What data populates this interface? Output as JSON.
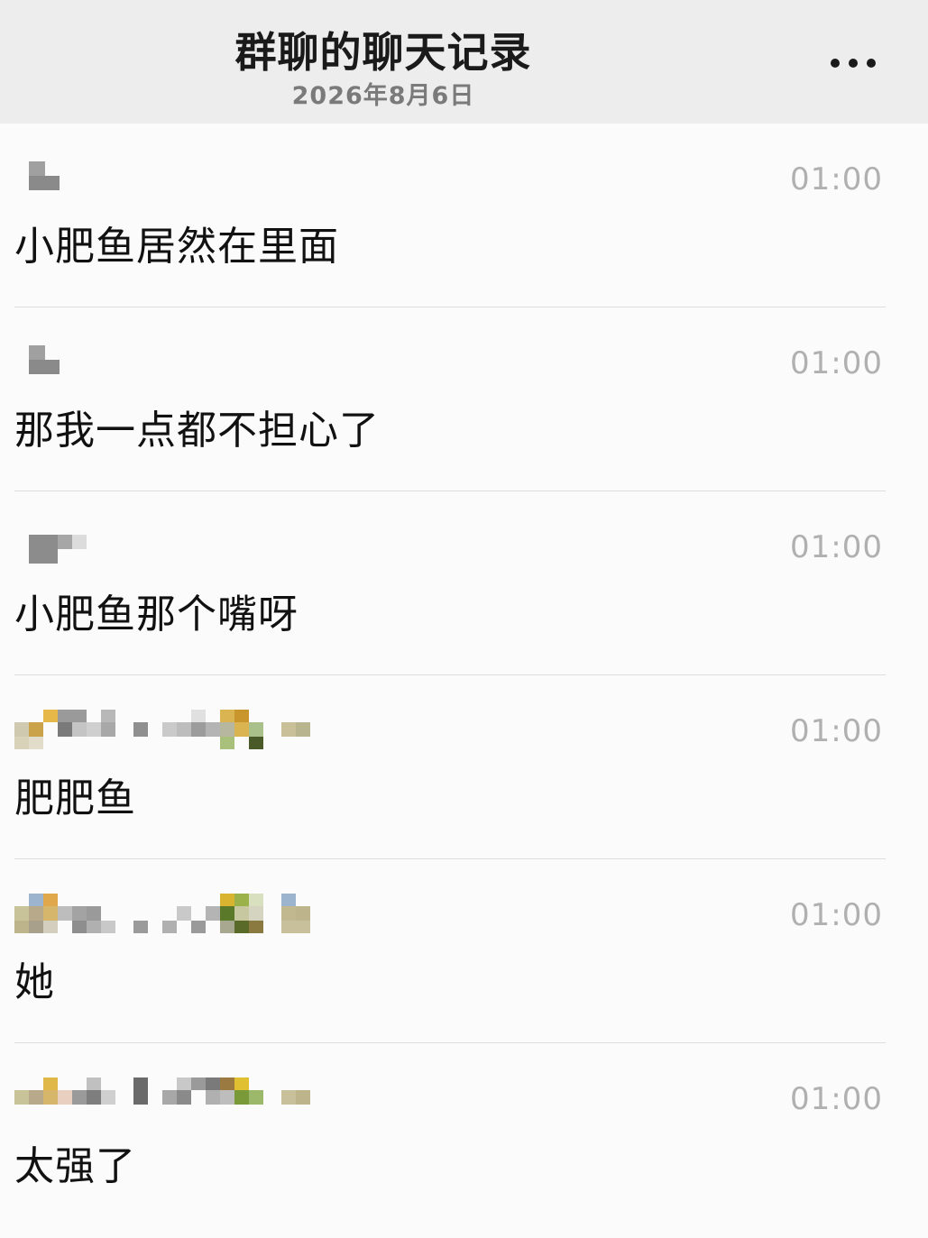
{
  "header": {
    "title": "群聊的聊天记录",
    "date": "2026年8月6日",
    "more_icon": "more-horizontal-icon"
  },
  "messages": [
    {
      "sender": "",
      "time": "01:00",
      "text": "小肥鱼居然在里面"
    },
    {
      "sender": "",
      "time": "01:00",
      "text": "那我一点都不担心了"
    },
    {
      "sender": "",
      "time": "01:00",
      "text": "小肥鱼那个嘴呀"
    },
    {
      "sender": "",
      "time": "01:00",
      "text": "肥肥鱼"
    },
    {
      "sender": "",
      "time": "01:00",
      "text": "她"
    },
    {
      "sender": "",
      "time": "01:00",
      "text": "太强了"
    }
  ],
  "colors": {
    "header_bg": "#ededed",
    "page_bg": "#fbfbfb",
    "time": "#b0b0b0",
    "divider": "#dedede"
  }
}
